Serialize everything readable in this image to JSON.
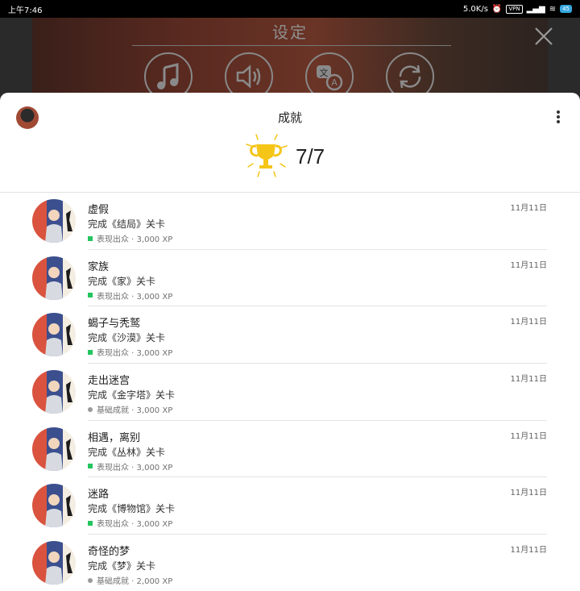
{
  "status_bar": {
    "time": "上午7:46",
    "speed": "5.0K/s",
    "vpn": "VPN",
    "battery": "45"
  },
  "game": {
    "title": "设定"
  },
  "sheet": {
    "title": "成就",
    "progress": "7/7"
  },
  "achievements": [
    {
      "title": "虚假",
      "desc": "完成《结局》关卡",
      "meta": "表现出众 · 3,000 XP",
      "date": "11月11日",
      "tier": "green"
    },
    {
      "title": "家族",
      "desc": "完成《家》关卡",
      "meta": "表现出众 · 3,000 XP",
      "date": "11月11日",
      "tier": "green"
    },
    {
      "title": "蝎子与秃鹫",
      "desc": "完成《沙漠》关卡",
      "meta": "表现出众 · 3,000 XP",
      "date": "11月11日",
      "tier": "green"
    },
    {
      "title": "走出迷宫",
      "desc": "完成《金字塔》关卡",
      "meta": "基础成就 · 3,000 XP",
      "date": "11月11日",
      "tier": "gray"
    },
    {
      "title": "相遇，离别",
      "desc": "完成《丛林》关卡",
      "meta": "表现出众 · 3,000 XP",
      "date": "11月11日",
      "tier": "green"
    },
    {
      "title": "迷路",
      "desc": "完成《博物馆》关卡",
      "meta": "表现出众 · 3,000 XP",
      "date": "11月11日",
      "tier": "green"
    },
    {
      "title": "奇怪的梦",
      "desc": "完成《梦》关卡",
      "meta": "基础成就 · 2,000 XP",
      "date": "11月11日",
      "tier": "gray"
    }
  ],
  "colors": {
    "green_badge": "#23c55e",
    "gray_badge": "#9a9a9a",
    "trophy": "#f5c518"
  }
}
